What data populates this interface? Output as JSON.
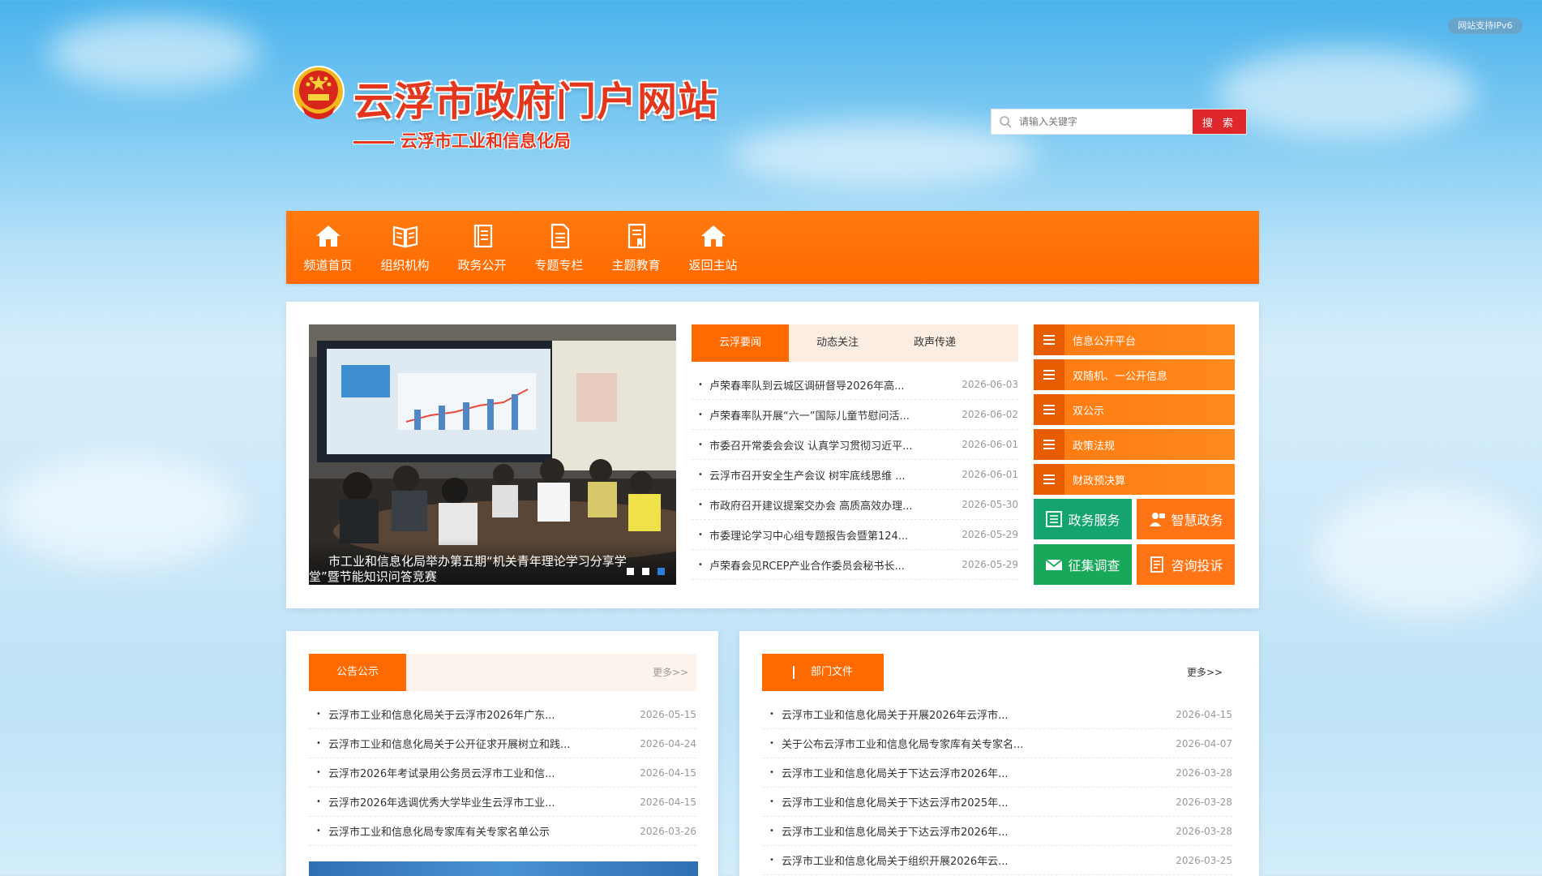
{
  "badge": {
    "ipv6": "网站支持IPv6"
  },
  "header": {
    "title": "云浮市政府门户网站",
    "subtitle": "云浮市工业和信息化局"
  },
  "search": {
    "placeholder": "请输入关键字",
    "button": "搜 索"
  },
  "nav": {
    "items": [
      {
        "label": "频道首页",
        "icon": "home-icon"
      },
      {
        "label": "组织机构",
        "icon": "book-icon"
      },
      {
        "label": "政务公开",
        "icon": "notebook-icon"
      },
      {
        "label": "专题专栏",
        "icon": "document-icon"
      },
      {
        "label": "主题教育",
        "icon": "bookmark-doc-icon"
      },
      {
        "label": "返回主站",
        "icon": "home-icon"
      }
    ]
  },
  "slider": {
    "caption": "市工业和信息化局举办第五期“机关青年理论学习分享学堂”暨节能知识问答竞赛",
    "slide_count": 3,
    "active_index": 2
  },
  "news": {
    "tabs": [
      "云浮要闻",
      "动态关注",
      "政声传递"
    ],
    "active_tab": 0,
    "items": [
      {
        "title": "卢荣春率队到云城区调研督导2026年高...",
        "date": "2026-06-03"
      },
      {
        "title": "卢荣春率队开展“六一”国际儿童节慰问活...",
        "date": "2026-06-02"
      },
      {
        "title": "市委召开常委会会议 认真学习贯彻习近平...",
        "date": "2026-06-01"
      },
      {
        "title": "云浮市召开安全生产会议 树牢底线思维 ...",
        "date": "2026-06-01"
      },
      {
        "title": "市政府召开建议提案交办会 高质高效办理...",
        "date": "2026-05-30"
      },
      {
        "title": "市委理论学习中心组专题报告会暨第124...",
        "date": "2026-05-29"
      },
      {
        "title": "卢荣春会见RCEP产业合作委员会秘书长...",
        "date": "2026-05-29"
      }
    ]
  },
  "side_links": [
    "信息公开平台",
    "双随机、一公开信息",
    "双公示",
    "政策法规",
    "财政预决算"
  ],
  "tiles": [
    {
      "label": "政务服务",
      "icon": "list-icon"
    },
    {
      "label": "智慧政务",
      "icon": "user-service-icon"
    },
    {
      "label": "征集调查",
      "icon": "mail-icon"
    },
    {
      "label": "咨询投诉",
      "icon": "form-icon"
    }
  ],
  "notices": {
    "title": "公告公示",
    "more": "更多>>",
    "items": [
      {
        "title": "云浮市工业和信息化局关于云浮市2026年广东...",
        "date": "2026-05-15"
      },
      {
        "title": "云浮市工业和信息化局关于公开征求开展树立和践...",
        "date": "2026-04-24"
      },
      {
        "title": "云浮市2026年考试录用公务员云浮市工业和信...",
        "date": "2026-04-15"
      },
      {
        "title": "云浮市2026年选调优秀大学毕业生云浮市工业...",
        "date": "2026-04-15"
      },
      {
        "title": "云浮市工业和信息化局专家库有关专家名单公示",
        "date": "2026-03-26"
      }
    ]
  },
  "dept_files": {
    "title": "部门文件",
    "more": "更多>>",
    "items": [
      {
        "title": "云浮市工业和信息化局关于开展2026年云浮市...",
        "date": "2026-04-15"
      },
      {
        "title": "关于公布云浮市工业和信息化局专家库有关专家名...",
        "date": "2026-04-07"
      },
      {
        "title": "云浮市工业和信息化局关于下达云浮市2026年...",
        "date": "2026-03-28"
      },
      {
        "title": "云浮市工业和信息化局关于下达云浮市2025年...",
        "date": "2026-03-28"
      },
      {
        "title": "云浮市工业和信息化局关于下达云浮市2026年...",
        "date": "2026-03-28"
      },
      {
        "title": "云浮市工业和信息化局关于组织开展2026年云...",
        "date": "2026-03-25"
      }
    ]
  },
  "colors": {
    "accent": "#ff6a00",
    "title_red": "#e4361d",
    "search_button": "#e0272c",
    "slider_active_dot": "#2a7fd7"
  }
}
